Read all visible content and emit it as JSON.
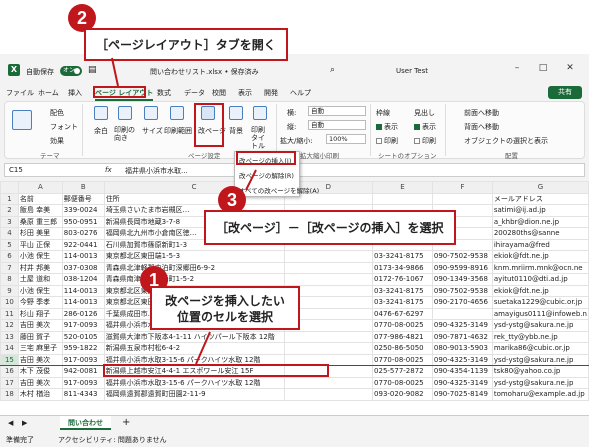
{
  "titlebar": {
    "autosave_label": "自動保存",
    "autosave_state": "オン",
    "filename": "問い合わせリスト.xlsx • 保存済み",
    "user": "User Test"
  },
  "menu": {
    "tabs": [
      "ファイル",
      "ホーム",
      "挿入",
      "ページ レイアウト",
      "数式",
      "データ",
      "校閲",
      "表示",
      "開発",
      "ヘルプ"
    ],
    "share_label": "共有"
  },
  "ribbon": {
    "theme": {
      "colors": "配色",
      "fonts": "フォント",
      "effects": "効果",
      "group": "テーマ"
    },
    "page_setup": {
      "margins": "余白",
      "orientation": "印刷の向き",
      "size": "サイズ",
      "print_area": "印刷範囲",
      "breaks": "改ページ",
      "background": "背景",
      "print_titles": "印刷タイトル",
      "group": "ページ設定"
    },
    "scale": {
      "width_label": "横:",
      "width_value": "自動",
      "height_label": "縦:",
      "height_value": "自動",
      "zoom_label": "拡大/縮小:",
      "zoom_value": "100%",
      "group": "拡大縮小印刷"
    },
    "sheet_options": {
      "gridlines": "枠線",
      "headings": "見出し",
      "view1": "表示",
      "view2": "表示",
      "print1": "印刷",
      "print2": "印刷",
      "group": "シートのオプション"
    },
    "arrange": {
      "bring_forward": "前面へ移動",
      "send_backward": "背面へ移動",
      "selection_pane": "オブジェクトの選択と表示",
      "group": "配置"
    }
  },
  "dropdown": {
    "items": [
      "改ページの挿入(I)",
      "改ページの解除(R)",
      "すべての改ページを解除(A)"
    ]
  },
  "formula_bar": {
    "cell_ref": "C15",
    "fx": "fx",
    "content": "福井県小浜市水取..."
  },
  "grid": {
    "columns": [
      "",
      "A",
      "B",
      "C",
      "D",
      "E",
      "F",
      "G"
    ],
    "rows": [
      [
        "1",
        "名前",
        "郵便番号",
        "住所",
        "",
        "",
        "",
        "メールアドレス"
      ],
      [
        "2",
        "飯島 幸美",
        "339-0024",
        "埼玉県さいたま市岩槻区…",
        "",
        "",
        "",
        "satimi@ij.ad.jp"
      ],
      [
        "3",
        "桑原 重三郎",
        "950-0951",
        "新潟県長岡市地蔵3-7-8",
        "",
        "",
        "",
        "a_khbr@dion.ne.jp"
      ],
      [
        "4",
        "杉田 美里",
        "803-0276",
        "福岡県北九州市小倉南区徳…",
        "",
        "",
        "",
        "200280ths@sanne"
      ],
      [
        "5",
        "平山 正保",
        "922-0441",
        "石川県加賀市篠原新町1-3",
        "",
        "",
        "",
        "ihirayama@fred"
      ],
      [
        "6",
        "小池 保生",
        "114-0013",
        "東京都北区東田端1-5-3",
        "",
        "03-3241-8175",
        "090-7502-9538",
        "ekiok@fdt.ne.jp"
      ],
      [
        "7",
        "村井 邦美",
        "037-0308",
        "青森県北津軽郡中泊町深郷田6-9-2",
        "",
        "0173-34-9866",
        "090-9599-8916",
        "knm.mriirm.mnk@ocn.ne"
      ],
      [
        "8",
        "土屋 道和",
        "038-1204",
        "青森県南津軽郡藤崎町1-5-2",
        "",
        "0172-76-1067",
        "090-1349-3568",
        "ayitut0110@dti.ad.jp"
      ],
      [
        "9",
        "小池 保生",
        "114-0013",
        "東京都北区東田端1-5-3",
        "",
        "03-3241-8175",
        "090-7502-9538",
        "ekiok@fdt.ne.jp"
      ],
      [
        "10",
        "今野 季孝",
        "114-0013",
        "東京都北区東田端1-5-3",
        "",
        "03-3241-8175",
        "090-2170-4656",
        "suetaka1229@cubic.or.jp"
      ],
      [
        "11",
        "杉山 翔子",
        "286-0126",
        "千葉県成田市…",
        "",
        "0476-67-6297",
        "",
        "amayigus0111@infoweb.n"
      ],
      [
        "12",
        "吉田 美次",
        "917-0093",
        "福井県小浜市水取3-15-6 パークハイツ水取 12階",
        "",
        "0770-08-0025",
        "090-4325-3149",
        "ysd-ystg@sakura.ne.jp"
      ],
      [
        "13",
        "藤田 賀子",
        "520-0105",
        "滋賀県大津市下阪本4-1-11 ハイツパール下阪本 12階",
        "",
        "077-986-4821",
        "090-7871-4632",
        "rek_tty@ybb.ne.jp"
      ],
      [
        "14",
        "三宅 麻里子",
        "959-1822",
        "新潟県五泉市村松6-4-2",
        "",
        "0250-86-5050",
        "080-9013-5903",
        "marika86@cubic.or.jp"
      ],
      [
        "15",
        "吉田 美次",
        "917-0093",
        "福井県小浜市水取3-15-6 パークハイツ水取 12階",
        "",
        "0770-08-0025",
        "090-4325-3149",
        "ysd-ystg@sakura.ne.jp"
      ],
      [
        "16",
        "木下 茂俊",
        "942-0081",
        "新潟県上越市安江4-4-1 エスポワール安江 15F",
        "",
        "025-577-2872",
        "090-4354-1139",
        "tsk80@yahoo.co.jp"
      ],
      [
        "17",
        "吉田 美次",
        "917-0093",
        "福井県小浜市水取3-15-6 パークハイツ水取 12階",
        "",
        "0770-08-0025",
        "090-4325-3149",
        "ysd-ystg@sakura.ne.jp"
      ],
      [
        "18",
        "木村 楢治",
        "811-4343",
        "福岡県遠賀郡遠賀町田園2-11-9",
        "",
        "093-020-9082",
        "090-7025-8149",
        "tomoharu@example.ad.jp"
      ]
    ]
  },
  "sheet_tabs": {
    "sheet": "問い合わせ",
    "add": "+"
  },
  "status": {
    "ready": "準備完了",
    "accessibility": "アクセシビリティ: 問題ありません"
  },
  "callouts": {
    "step2_num": "2",
    "step2_text": "［ページレイアウト］タブを開く",
    "step3_num": "3",
    "step3_text": "［改ページ］－［改ページの挿入］を選択",
    "step1_num": "1",
    "step1_line1": "改ページを挿入したい",
    "step1_line2": "位置のセルを選択"
  }
}
